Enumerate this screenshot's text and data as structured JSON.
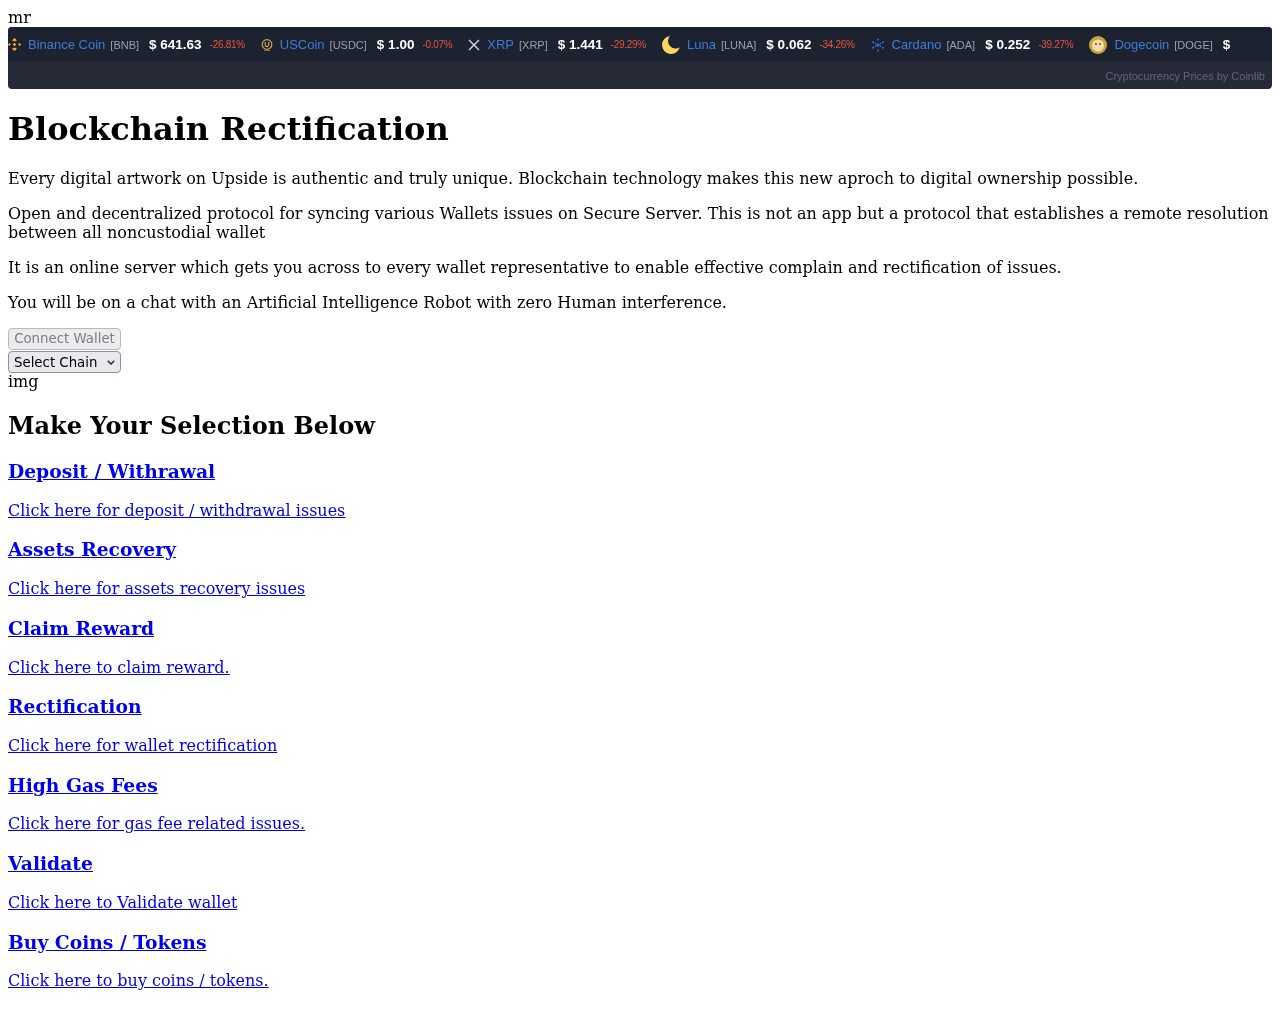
{
  "top_text": "mr",
  "ticker": {
    "coins": [
      {
        "name": "Binance Coin",
        "symbol": "[BNB]",
        "price": "$ 641.63",
        "change": "-26.81%"
      },
      {
        "name": "USCoin",
        "symbol": "[USDC]",
        "price": "$ 1.00",
        "change": "-0.07%"
      },
      {
        "name": "XRP",
        "symbol": "[XRP]",
        "price": "$ 1.441",
        "change": "-29.29%"
      },
      {
        "name": "Luna",
        "symbol": "[LUNA]",
        "price": "$ 0.062",
        "change": "-34.26%"
      },
      {
        "name": "Cardano",
        "symbol": "[ADA]",
        "price": "$ 0.252",
        "change": "-39.27%"
      },
      {
        "name": "Dogecoin",
        "symbol": "[DOGE]",
        "price": "$"
      }
    ],
    "credit": "Cryptocurrency Prices by Coinlib"
  },
  "title": "Blockchain Rectification",
  "paragraphs": [
    "Every digital artwork on Upside is authentic and truly unique. Blockchain technology makes this new aproch to digital ownership possible.",
    "Open and decentralized protocol for syncing various Wallets issues on Secure Server. This is not an app but a protocol that establishes a remote resolution between all noncustodial wallet",
    "It is an online server which gets you across to every wallet representative to enable effective complain and rectification of issues.",
    "You will be on a chat with an Artificial Intelligence Robot with zero Human interference."
  ],
  "connect_button": {
    "label": "Connect Wallet",
    "disabled": true
  },
  "chain_select": {
    "value": "Select Chain"
  },
  "image_alt": "img",
  "selection_heading": "Make Your Selection Below",
  "options": [
    {
      "heading": "Deposit / Withrawal",
      "link": "Click here for deposit / withdrawal issues"
    },
    {
      "heading": "Assets Recovery",
      "link": "Click here for assets recovery issues"
    },
    {
      "heading": "Claim Reward",
      "link": "Click here to claim reward."
    },
    {
      "heading": "Rectification",
      "link": "Click here for wallet rectification"
    },
    {
      "heading": "High Gas Fees",
      "link": "Click here for gas fee related issues."
    },
    {
      "heading": "Validate",
      "link": "Click here to Validate wallet"
    },
    {
      "heading": "Buy Coins / Tokens",
      "link": "Click here to buy coins / tokens."
    }
  ]
}
